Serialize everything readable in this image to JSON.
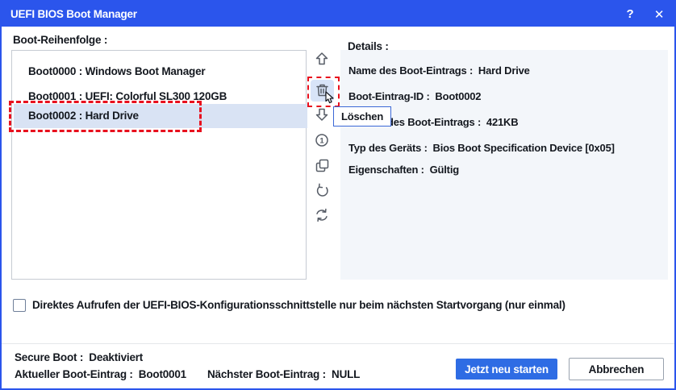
{
  "window": {
    "title": "UEFI BIOS Boot Manager",
    "help_label": "?",
    "close_label": "✕",
    "colors": {
      "titlebar": "#2b55ec",
      "accent_button": "#2e6ce4",
      "selection_highlight": "#d9e3f4",
      "danger_dashed": "#e8101e",
      "details_panel_bg": "#f3f6fa"
    }
  },
  "boot_order": {
    "label": "Boot-Reihenfolge :",
    "items": [
      {
        "text": "Boot0000 : Windows Boot Manager",
        "selected": false
      },
      {
        "text": "Boot0001 : UEFI: Colorful SL300 120GB",
        "selected": false
      },
      {
        "text": "Boot0002 : Hard Drive",
        "selected": true
      }
    ]
  },
  "toolbar": {
    "icons": [
      "move-up-icon",
      "delete-icon",
      "move-down-icon",
      "boot-once-icon",
      "copy-icon",
      "undo-icon",
      "refresh-icon"
    ],
    "boot_once_glyph": "1"
  },
  "tooltip": {
    "text": "Löschen"
  },
  "details": {
    "label": "Details :",
    "rows": [
      {
        "text": "Name des Boot-Eintrags :  Hard Drive"
      },
      {
        "text": "Boot-Eintrag-ID :  Boot0002"
      },
      {
        "text": "des Boot-Eintrags :  421KB"
      },
      {
        "text": "Typ des Geräts :  Bios Boot Specification Device [0x05]"
      },
      {
        "text": "Eigenschaften :  Gültig"
      }
    ]
  },
  "options": {
    "checkbox_checked": false,
    "checkbox_label": "Direktes Aufrufen der UEFI-BIOS-Konfigurationsschnittstelle nur beim nächsten Startvorgang (nur einmal)"
  },
  "status": {
    "secure_boot": "Secure Boot :  Deaktiviert",
    "current_entry": "Aktueller Boot-Eintrag :  Boot0001",
    "next_entry": "Nächster Boot-Eintrag :  NULL"
  },
  "footer_buttons": {
    "restart": "Jetzt neu starten",
    "cancel": "Abbrechen"
  }
}
